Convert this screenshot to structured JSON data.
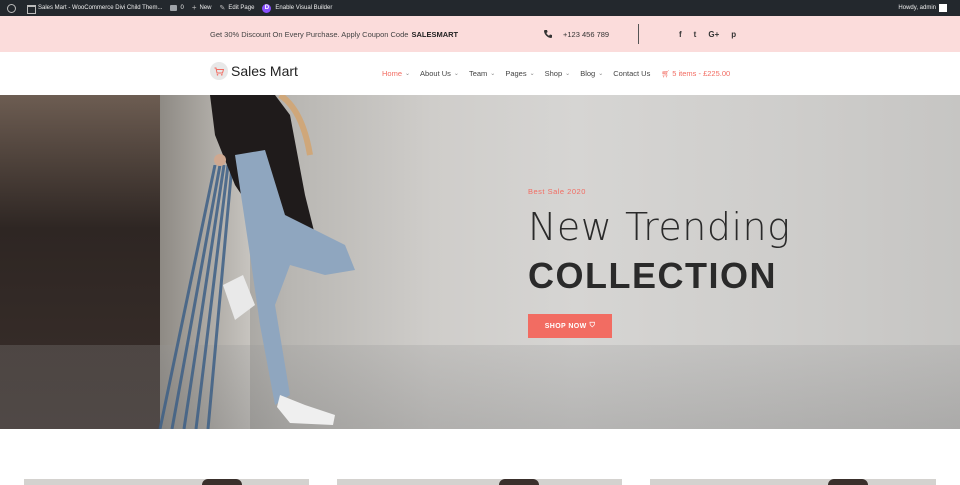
{
  "admin_bar": {
    "site_name": "Sales Mart - WooCommerce Divi Child Them...",
    "comments_count": "0",
    "new_label": "New",
    "edit_label": "Edit Page",
    "builder_label": "Enable Visual Builder",
    "greeting": "Howdy, admin"
  },
  "promo": {
    "text": "Get 30% Discount On Every Purchase. Apply Coupon Code",
    "code": "SALESMART",
    "phone": "+123 456 789",
    "social": [
      "f",
      "t",
      "G+",
      "p"
    ]
  },
  "header": {
    "logo_text": "Sales Mart",
    "nav": [
      {
        "label": "Home",
        "dropdown": true,
        "active": true
      },
      {
        "label": "About Us",
        "dropdown": true,
        "active": false
      },
      {
        "label": "Team",
        "dropdown": true,
        "active": false
      },
      {
        "label": "Pages",
        "dropdown": true,
        "active": false
      },
      {
        "label": "Shop",
        "dropdown": true,
        "active": false
      },
      {
        "label": "Blog",
        "dropdown": true,
        "active": false
      },
      {
        "label": "Contact Us",
        "dropdown": false,
        "active": false
      }
    ],
    "cart_text": "5 items - £225.00"
  },
  "hero": {
    "subtitle": "Best Sale 2020",
    "title_line1": "New Trending",
    "title_line2": "COLLECTION",
    "button_label": "SHOP NOW"
  },
  "colors": {
    "accent": "#f26c62",
    "promo_bg": "#fbdcdb",
    "admin_bg": "#23282d"
  }
}
